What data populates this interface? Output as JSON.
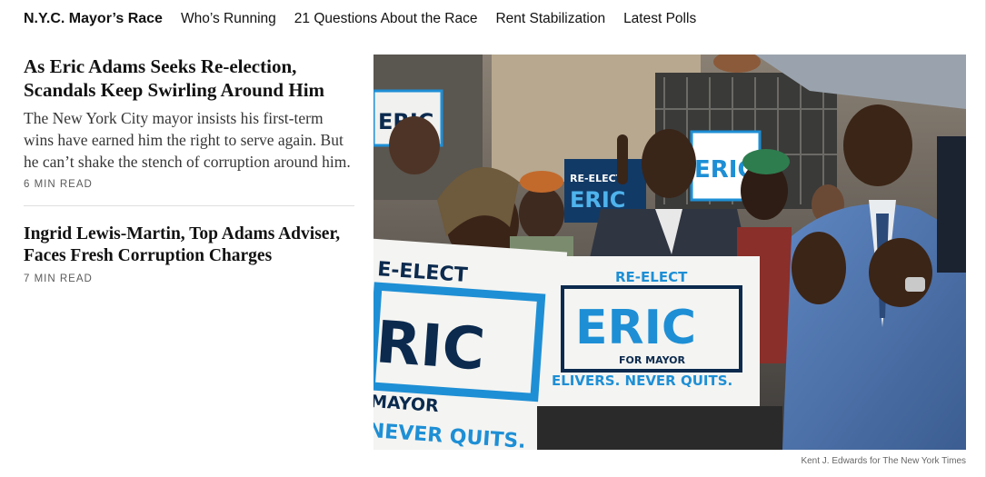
{
  "nav": {
    "title": "N.Y.C. Mayor’s Race",
    "links": [
      "Who’s Running",
      "21 Questions About the Race",
      "Rent Stabilization",
      "Latest Polls"
    ]
  },
  "stories": [
    {
      "headline": "As Eric Adams Seeks Re-election, Scandals Keep Swirling Around Him",
      "summary": "The New York City mayor insists his first-term wins have earned him the right to serve again. But he can’t shake the stench of corruption around him.",
      "read_time": "6 MIN READ"
    },
    {
      "headline": "Ingrid Lewis-Martin, Top Adams Adviser, Faces Fresh Corruption Charges",
      "read_time": "7 MIN READ"
    }
  ],
  "photo": {
    "credit": "Kent J. Edwards for The New York Times",
    "signs": {
      "left_top": "E-ELECT",
      "left_big": "RIC",
      "left_mayor": "MAYOR",
      "left_bottom": "NEVER QUITS.",
      "center_top": "RE-ELECT",
      "center_big": "ERIC",
      "center_mayor": "FOR MAYOR",
      "center_bottom": "ELIVERS. NEVER QUITS.",
      "back_left": "ERIC",
      "back_center": "RE-ELECT",
      "back_center_big": "ERIC",
      "back_right": "ERIC"
    }
  },
  "colors": {
    "sign_blue": "#1e8fd5",
    "sign_navy": "#0b2a4e",
    "sign_white": "#f4f4f2"
  }
}
